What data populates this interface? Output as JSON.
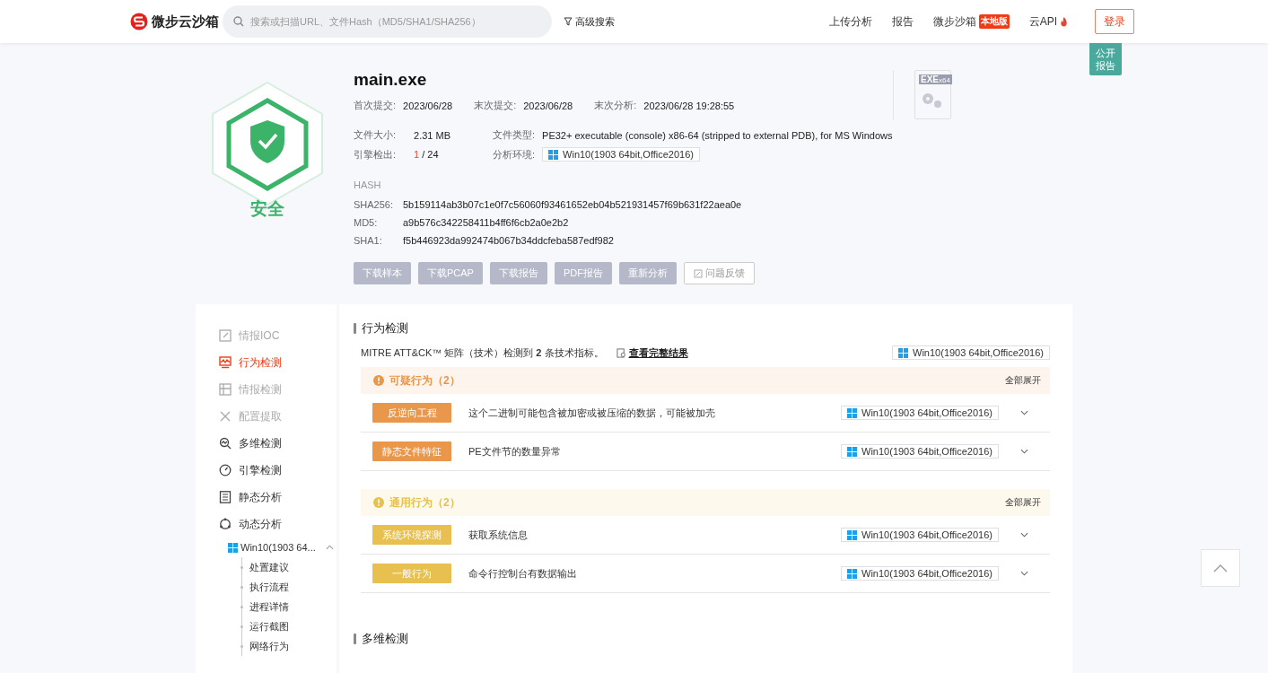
{
  "header": {
    "brand": "微步云沙箱",
    "search": {
      "placeholder": "搜索或扫描URL、文件Hash（MD5/SHA1/SHA256）"
    },
    "advanced_search": "高级搜索",
    "nav": [
      {
        "label": "上传分析"
      },
      {
        "label": "报告"
      },
      {
        "label": "微步沙箱",
        "badge": "本地版"
      },
      {
        "label": "云API",
        "hot": true
      }
    ],
    "login": "登录"
  },
  "public_report": "公开报告",
  "verdict": {
    "label": "安全",
    "kind": "safe"
  },
  "file": {
    "name": "main.exe",
    "dates": [
      {
        "label": "首次提交:",
        "value": "2023/06/28"
      },
      {
        "label": "末次提交:",
        "value": "2023/06/28"
      },
      {
        "label": "末次分析:",
        "value": "2023/06/28 19:28:55"
      }
    ],
    "size": {
      "label": "文件大小:",
      "value": "2.31 MB"
    },
    "type": {
      "label": "文件类型:",
      "value": "PE32+ executable (console) x86-64 (stripped to external PDB), for MS Windows"
    },
    "engines": {
      "label": "引擎检出:",
      "hits": "1",
      "rest": "/ 24"
    },
    "environment": {
      "label": "分析环境:",
      "value": "Win10(1903 64bit,Office2016)"
    },
    "hash_title": "HASH",
    "hashes": [
      {
        "label": "SHA256:",
        "value": "5b159114ab3b07c1e0f7c56060f93461652eb04b521931457f69b631f22aea0e"
      },
      {
        "label": "MD5:",
        "value": "a9b576c342258411b4ff6f6cb2a0e2b2"
      },
      {
        "label": "SHA1:",
        "value": "f5b446923da992474b067b34ddcfeba587edf982"
      }
    ],
    "icon": {
      "label": "EXE",
      "arch": "x64"
    }
  },
  "actions": [
    {
      "label": "下载样本",
      "kind": "filled"
    },
    {
      "label": "下载PCAP",
      "kind": "filled"
    },
    {
      "label": "下载报告",
      "kind": "filled"
    },
    {
      "label": "PDF报告",
      "kind": "filled"
    },
    {
      "label": "重新分析",
      "kind": "filled"
    },
    {
      "label": "问题反馈",
      "kind": "outline"
    }
  ],
  "sidebar": {
    "items": [
      {
        "label": "情报IOC",
        "selected": false,
        "disabled": true
      },
      {
        "label": "行为检测",
        "selected": true,
        "disabled": false
      },
      {
        "label": "情报检测",
        "selected": false,
        "disabled": true
      },
      {
        "label": "配置提取",
        "selected": false,
        "disabled": true
      },
      {
        "label": "多维检测",
        "selected": false,
        "disabled": false
      },
      {
        "label": "引擎检测",
        "selected": false,
        "disabled": false
      },
      {
        "label": "静态分析",
        "selected": false,
        "disabled": false
      },
      {
        "label": "动态分析",
        "selected": false,
        "disabled": false,
        "children": [
          {
            "label": "Win10(1903 64...",
            "expanded": true,
            "children": [
              {
                "label": "处置建议"
              },
              {
                "label": "执行流程"
              },
              {
                "label": "进程详情"
              },
              {
                "label": "运行截图"
              },
              {
                "label": "网络行为"
              }
            ]
          }
        ]
      }
    ]
  },
  "behavior": {
    "title": "行为检测",
    "summary": "MITRE ATT&CK™ 矩阵（技术）检测到 **2** 条技术指标。",
    "link": "查看完整结果",
    "environment": "Win10(1903 64bit,Office2016)",
    "groups": [
      {
        "title": "可疑行为（2）",
        "color": "#e9974b",
        "expand_all": "全部展开",
        "rows": [
          {
            "tag": "反逆向工程",
            "description": "这个二进制可能包含被加密或被压缩的数据，可能被加壳",
            "environment": "Win10(1903 64bit,Office2016)",
            "expanded": false
          },
          {
            "tag": "静态文件特征",
            "description": "PE文件节的数量异常",
            "environment": "Win10(1903 64bit,Office2016)",
            "expanded": false
          }
        ]
      },
      {
        "title": "通用行为（2）",
        "color": "#e8c050",
        "expand_all": "全部展开",
        "rows": [
          {
            "tag": "系统环境探测",
            "description": "获取系统信息",
            "environment": "Win10(1903 64bit,Office2016)",
            "expanded": false
          },
          {
            "tag": "一般行为",
            "description": "命令行控制台有数据输出",
            "environment": "Win10(1903 64bit,Office2016)",
            "expanded": false
          }
        ]
      }
    ]
  },
  "next_section": {
    "title": "多维检测"
  }
}
